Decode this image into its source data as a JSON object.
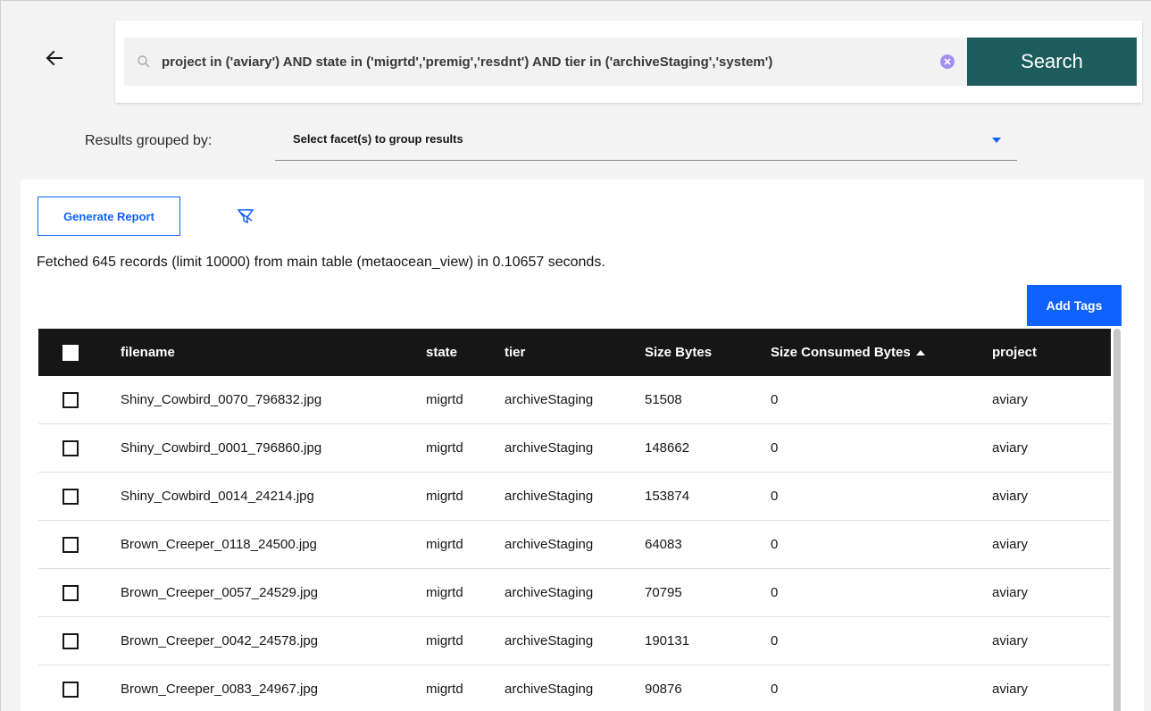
{
  "search": {
    "query": "project in ('aviary') AND state in ('migrtd','premig','resdnt') AND tier in ('archiveStaging','system')",
    "button_label": "Search"
  },
  "grouping": {
    "label": "Results grouped by:",
    "placeholder": "Select facet(s) to group results"
  },
  "toolbar": {
    "generate_report_label": "Generate Report",
    "add_tags_label": "Add Tags"
  },
  "status": {
    "fetched_text": "Fetched 645 records (limit 10000) from main table (metaocean_view) in 0.10657 seconds."
  },
  "table": {
    "columns": [
      "filename",
      "state",
      "tier",
      "Size Bytes",
      "Size Consumed Bytes",
      "project"
    ],
    "sorted_column": "Size Consumed Bytes",
    "sort_direction": "ascending",
    "rows": [
      [
        "Shiny_Cowbird_0070_796832.jpg",
        "migrtd",
        "archiveStaging",
        "51508",
        "0",
        "aviary"
      ],
      [
        "Shiny_Cowbird_0001_796860.jpg",
        "migrtd",
        "archiveStaging",
        "148662",
        "0",
        "aviary"
      ],
      [
        "Shiny_Cowbird_0014_24214.jpg",
        "migrtd",
        "archiveStaging",
        "153874",
        "0",
        "aviary"
      ],
      [
        "Brown_Creeper_0118_24500.jpg",
        "migrtd",
        "archiveStaging",
        "64083",
        "0",
        "aviary"
      ],
      [
        "Brown_Creeper_0057_24529.jpg",
        "migrtd",
        "archiveStaging",
        "70795",
        "0",
        "aviary"
      ],
      [
        "Brown_Creeper_0042_24578.jpg",
        "migrtd",
        "archiveStaging",
        "190131",
        "0",
        "aviary"
      ],
      [
        "Brown_Creeper_0083_24967.jpg",
        "migrtd",
        "archiveStaging",
        "90876",
        "0",
        "aviary"
      ]
    ]
  },
  "colors": {
    "search_button": "#1d5c5c",
    "primary_blue": "#0f62fe",
    "header_dark": "#161616"
  },
  "icons": [
    "back-arrow-icon",
    "search-icon",
    "clear-icon",
    "chevron-down-icon",
    "filter-icon",
    "sort-ascending-icon"
  ]
}
